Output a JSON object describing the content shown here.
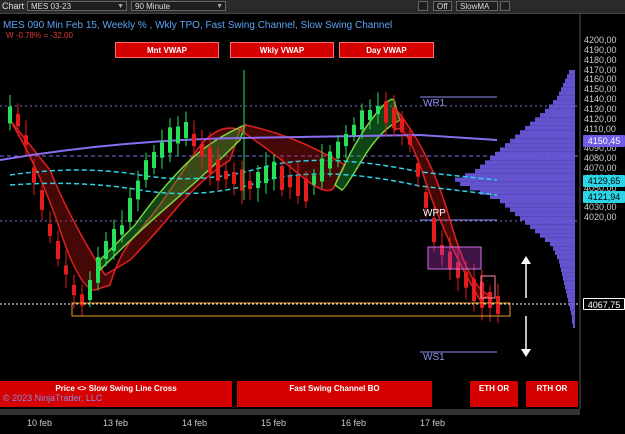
{
  "toolbar": {
    "chart_label": "Chart",
    "instrument": "MES 03-23",
    "interval": "90 Minute",
    "off_label": "Off",
    "indicator": "SlowMA"
  },
  "header": {
    "title": "MES 090 Min Feb 15, Weekly % , Wkly TPO, Fast Swing Channel, Slow Swing Channel",
    "change": "W -0.78% = -32.00"
  },
  "vwap_buttons": [
    "Mnt VWAP",
    "Wkly VWAP",
    "Day VWAP"
  ],
  "bottom_buttons": {
    "price_cross": "Price <> Slow Swing Line Cross",
    "fast_channel": "Fast Swing Channel BO",
    "eth": "ETH OR",
    "rth": "RTH OR"
  },
  "copyright": "© 2023 NinjaTrader, LLC",
  "chart_labels": {
    "wr1": "WR1",
    "wpp": "WPP",
    "ws1": "WS1"
  },
  "price_axis": [
    "4200,00",
    "4190,00",
    "4180,00",
    "4170,00",
    "4160,00",
    "4150,00",
    "4140,00",
    "4130,00",
    "4120,00",
    "4110,00",
    "4100,00",
    "4090,00",
    "4080,00",
    "4070,00",
    "4060,00",
    "4050,00",
    "4040,00",
    "4030,00",
    "4020,00"
  ],
  "price_tags": {
    "weekly_level": "4150,45",
    "upper_band": "4129,65",
    "lower_band": "4121,94",
    "last_price": "4067,75"
  },
  "date_axis": [
    "10 feb",
    "13 feb",
    "14 feb",
    "15 feb",
    "16 feb",
    "17 feb"
  ],
  "colors": {
    "up": "#26e05a",
    "down": "#e51c1c",
    "fast_channel_green": "#7ad63c",
    "fast_channel_red": "#e02020",
    "slow_line": "#8a6cf0",
    "band": "#2ad4e6",
    "profile": "#6e5ce6",
    "accent_blue": "#5da3f5"
  }
}
